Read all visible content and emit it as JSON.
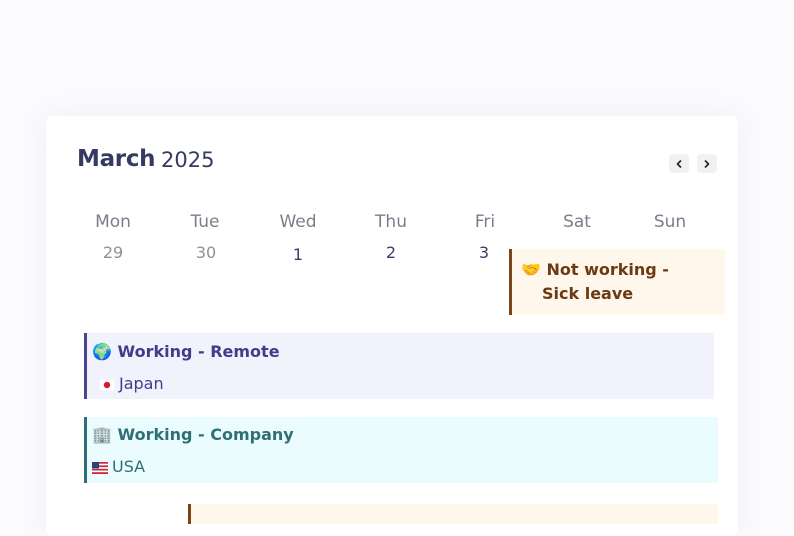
{
  "calendar": {
    "month": "March",
    "year": "2025",
    "nav": {
      "prev_icon": "chevron-left-icon",
      "next_icon": "chevron-right-icon"
    },
    "weekdays": [
      "Mon",
      "Tue",
      "Wed",
      "Thu",
      "Fri",
      "Sat",
      "Sun"
    ],
    "days": [
      "29",
      "30",
      "1",
      "2",
      "3"
    ]
  },
  "events": {
    "sick": {
      "emoji": "🤝",
      "title_line1": "Not working -",
      "title_line2": "Sick leave"
    },
    "remote": {
      "emoji": "🌍",
      "title": "Working - Remote",
      "location": "Japan",
      "location_flag": "japan-flag-icon"
    },
    "company": {
      "emoji": "🏢",
      "title": "Working - Company",
      "location": "USA",
      "location_flag": "usa-flag-icon"
    }
  },
  "colors": {
    "title": "#363a62",
    "sick_bg": "#fff6ec",
    "sick_accent": "#7a4318",
    "remote_bg": "#f2f2fd",
    "remote_accent": "#4a4392",
    "company_bg": "#eafcfd",
    "company_accent": "#2f6f76"
  }
}
